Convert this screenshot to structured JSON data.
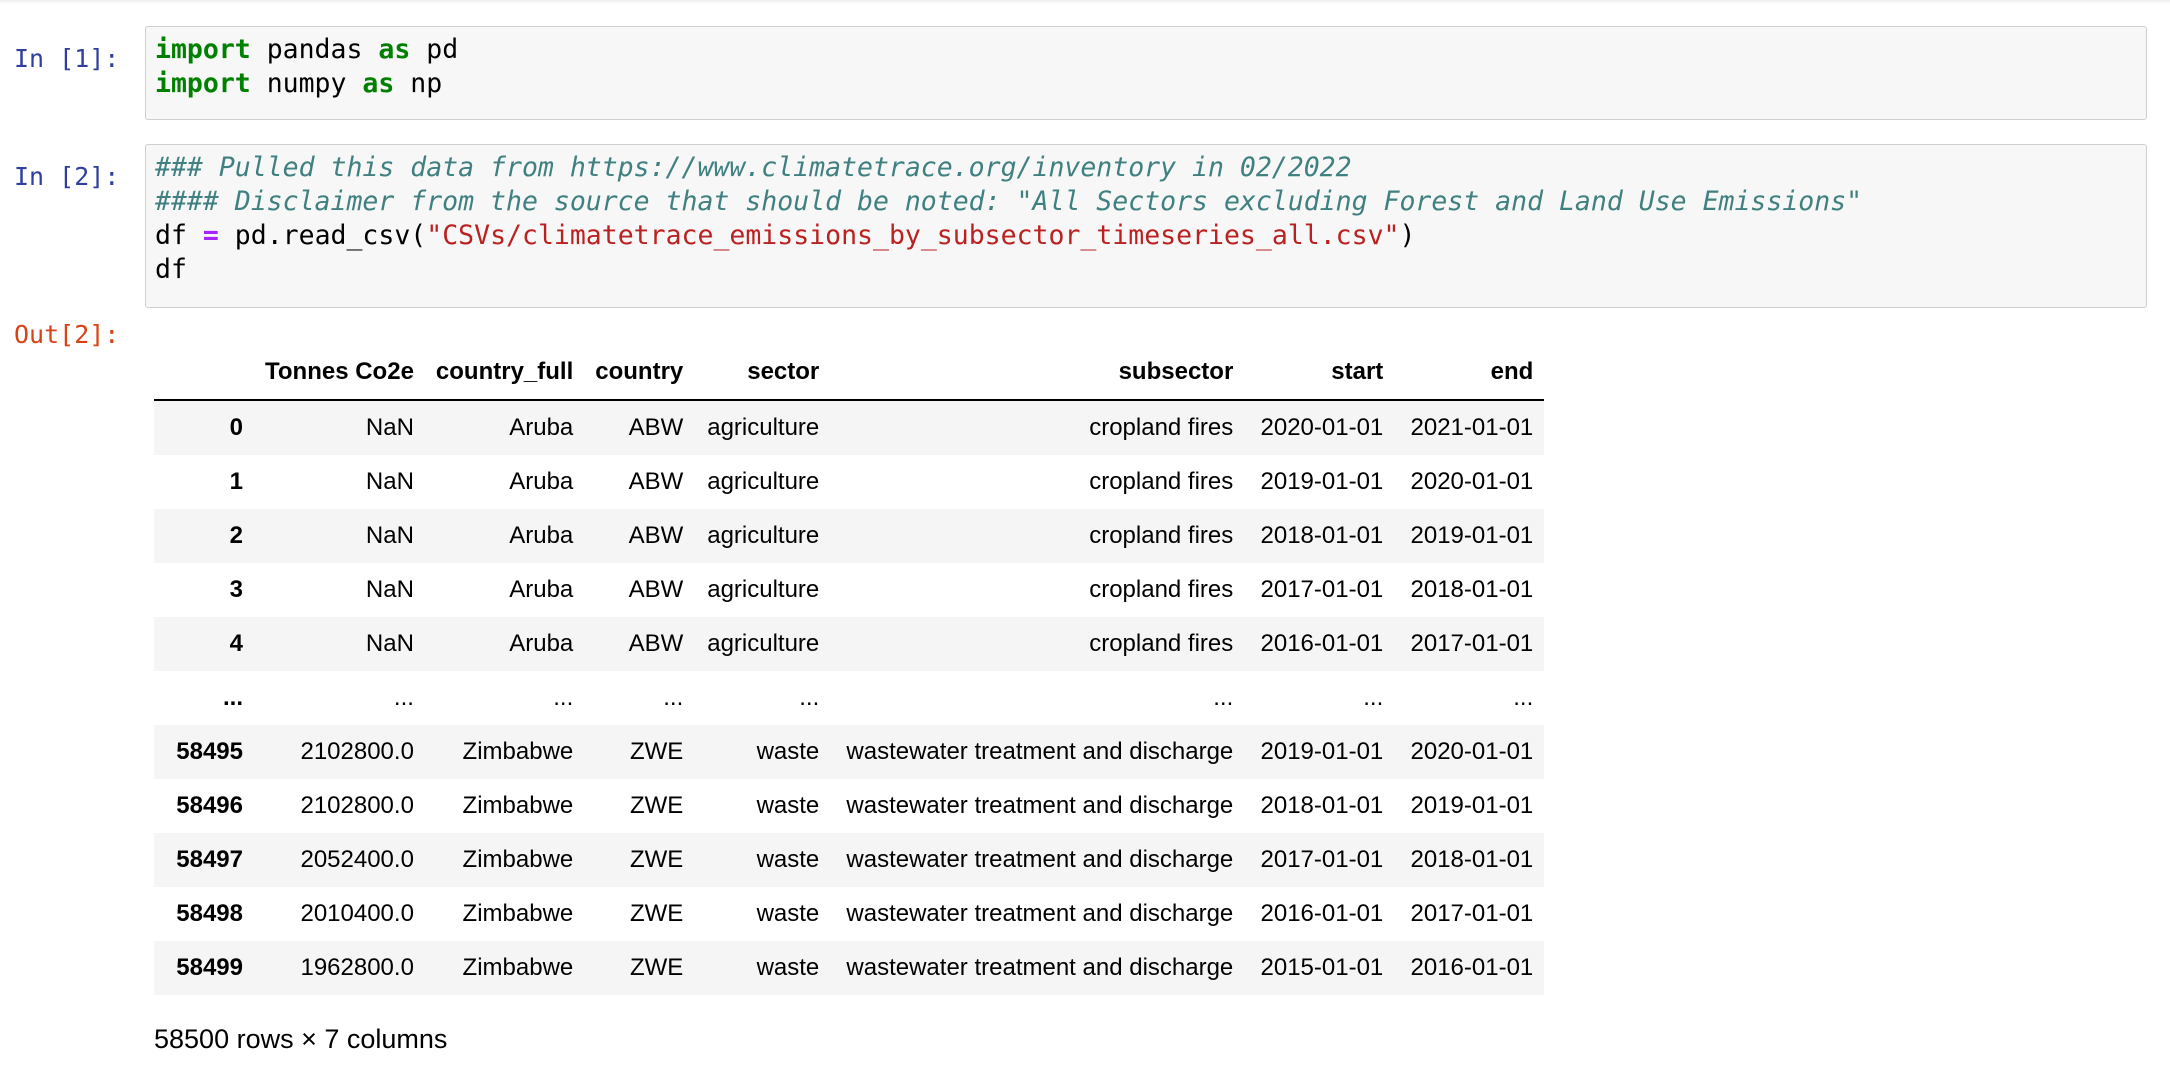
{
  "cells": [
    {
      "prompt": "In [1]:",
      "lines": [
        [
          {
            "t": "import",
            "k": "kw"
          },
          {
            "t": " pandas ",
            "k": ""
          },
          {
            "t": "as",
            "k": "kw"
          },
          {
            "t": " pd",
            "k": ""
          }
        ],
        [
          {
            "t": "import",
            "k": "kw"
          },
          {
            "t": " numpy ",
            "k": ""
          },
          {
            "t": "as",
            "k": "kw"
          },
          {
            "t": " np",
            "k": ""
          }
        ]
      ]
    },
    {
      "prompt": "In [2]:",
      "lines": [
        [
          {
            "t": "### Pulled this data from https://www.climatetrace.org/inventory in 02/2022",
            "k": "cm"
          }
        ],
        [
          {
            "t": "#### Disclaimer from the source that should be noted: \"All Sectors excluding Forest and Land Use Emissions\"",
            "k": "cm"
          }
        ],
        [
          {
            "t": "df ",
            "k": ""
          },
          {
            "t": "=",
            "k": "op"
          },
          {
            "t": " pd.read_csv(",
            "k": ""
          },
          {
            "t": "\"CSVs/climatetrace_emissions_by_subsector_timeseries_all.csv\"",
            "k": "str"
          },
          {
            "t": ")",
            "k": ""
          }
        ],
        [
          {
            "t": "df",
            "k": ""
          }
        ]
      ]
    }
  ],
  "output": {
    "prompt": "Out[2]:",
    "columns": [
      "",
      "Tonnes Co2e",
      "country_full",
      "country",
      "sector",
      "subsector",
      "start",
      "end"
    ],
    "rows": [
      [
        "0",
        "NaN",
        "Aruba",
        "ABW",
        "agriculture",
        "cropland fires",
        "2020-01-01",
        "2021-01-01"
      ],
      [
        "1",
        "NaN",
        "Aruba",
        "ABW",
        "agriculture",
        "cropland fires",
        "2019-01-01",
        "2020-01-01"
      ],
      [
        "2",
        "NaN",
        "Aruba",
        "ABW",
        "agriculture",
        "cropland fires",
        "2018-01-01",
        "2019-01-01"
      ],
      [
        "3",
        "NaN",
        "Aruba",
        "ABW",
        "agriculture",
        "cropland fires",
        "2017-01-01",
        "2018-01-01"
      ],
      [
        "4",
        "NaN",
        "Aruba",
        "ABW",
        "agriculture",
        "cropland fires",
        "2016-01-01",
        "2017-01-01"
      ],
      [
        "...",
        "...",
        "...",
        "...",
        "...",
        "...",
        "...",
        "..."
      ],
      [
        "58495",
        "2102800.0",
        "Zimbabwe",
        "ZWE",
        "waste",
        "wastewater treatment and discharge",
        "2019-01-01",
        "2020-01-01"
      ],
      [
        "58496",
        "2102800.0",
        "Zimbabwe",
        "ZWE",
        "waste",
        "wastewater treatment and discharge",
        "2018-01-01",
        "2019-01-01"
      ],
      [
        "58497",
        "2052400.0",
        "Zimbabwe",
        "ZWE",
        "waste",
        "wastewater treatment and discharge",
        "2017-01-01",
        "2018-01-01"
      ],
      [
        "58498",
        "2010400.0",
        "Zimbabwe",
        "ZWE",
        "waste",
        "wastewater treatment and discharge",
        "2016-01-01",
        "2017-01-01"
      ],
      [
        "58499",
        "1962800.0",
        "Zimbabwe",
        "ZWE",
        "waste",
        "wastewater treatment and discharge",
        "2015-01-01",
        "2016-01-01"
      ]
    ],
    "shape": "58500 rows × 7 columns"
  },
  "colors": {
    "in_prompt": "#303f9f",
    "out_prompt": "#d84315",
    "keyword": "#008000",
    "comment": "#408080",
    "string": "#ba2121",
    "operator": "#aa22ff"
  }
}
